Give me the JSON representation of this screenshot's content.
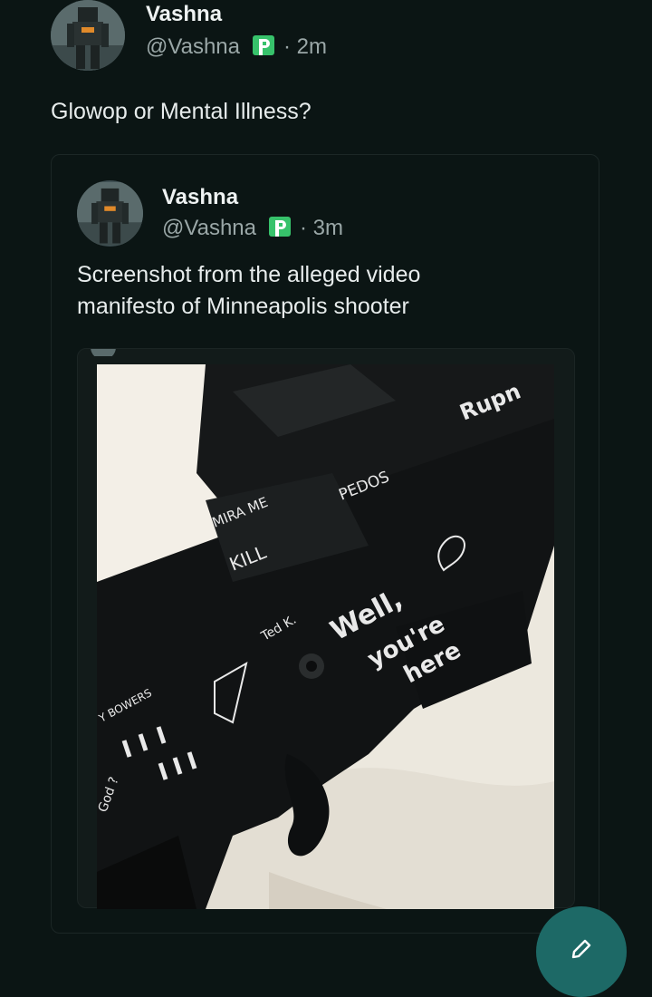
{
  "post": {
    "author_name": "Vashna",
    "handle": "@Vashna",
    "time": "· 2m",
    "text": "Glowop or Mental Illness?"
  },
  "quoted_post": {
    "author_name": "Vashna",
    "handle": "@Vashna",
    "time": "· 3m",
    "text_line1": "Screenshot from the alleged video",
    "text_line2": "manifesto of Minneapolis shooter"
  },
  "media": {
    "engravings": [
      "MIRA ME",
      "KILL",
      "PEDOS",
      "Ted K.",
      "Well,",
      "you're",
      "here",
      "Rupn",
      "Y BOWERS",
      "God ?"
    ]
  },
  "icons": {
    "badge": "platform-badge-icon",
    "compose": "pencil-icon"
  },
  "colors": {
    "background": "#0b1514",
    "text": "#e7ecec",
    "muted": "#9aa7a7",
    "badge_green": "#37c26b",
    "fab": "#1d6966"
  }
}
